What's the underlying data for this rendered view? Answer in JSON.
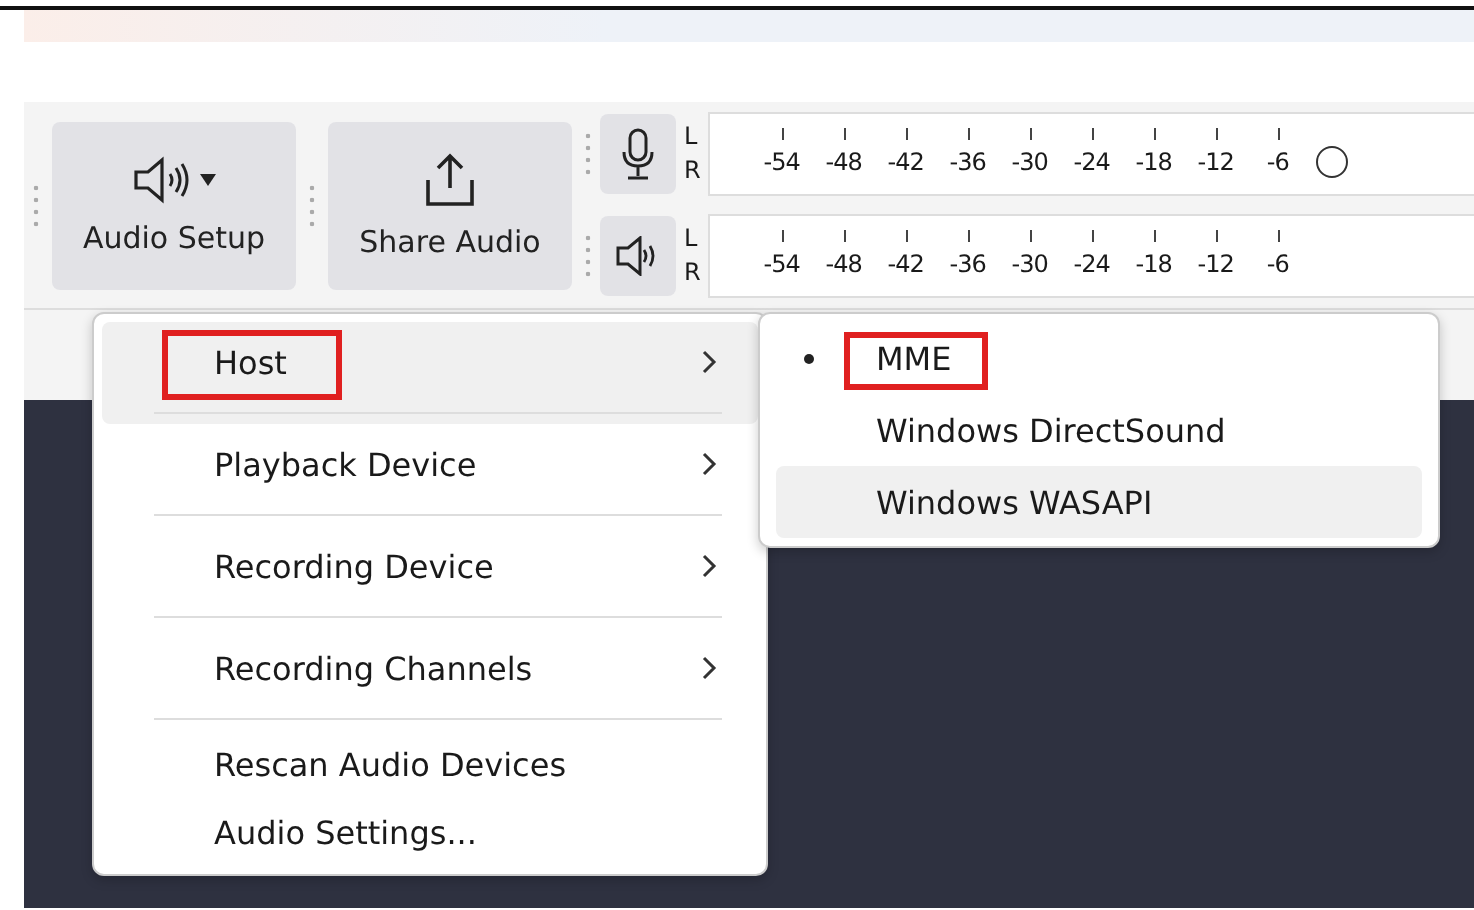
{
  "toolbar": {
    "buttons": [
      {
        "label": "Audio Setup",
        "kind": "speaker",
        "dropdown": true
      },
      {
        "label": "Share Audio",
        "kind": "share",
        "dropdown": false
      }
    ]
  },
  "meters": [
    {
      "kind": "recording",
      "channels": [
        "L",
        "R"
      ],
      "ticks": [
        "-54",
        "-48",
        "-42",
        "-36",
        "-30",
        "-24",
        "-18",
        "-12",
        "-6"
      ],
      "end_mark": true
    },
    {
      "kind": "playback",
      "channels": [
        "L",
        "R"
      ],
      "ticks": [
        "-54",
        "-48",
        "-42",
        "-36",
        "-30",
        "-24",
        "-18",
        "-12",
        "-6"
      ],
      "end_mark": false
    }
  ],
  "menu": {
    "items": [
      {
        "label": "Host",
        "kind": "submenu",
        "hovered": true,
        "annotated": true,
        "separator_after": true
      },
      {
        "label": "Playback Device",
        "kind": "submenu",
        "hovered": false,
        "annotated": false,
        "separator_after": true
      },
      {
        "label": "Recording Device",
        "kind": "submenu",
        "hovered": false,
        "annotated": false,
        "separator_after": true
      },
      {
        "label": "Recording Channels",
        "kind": "submenu",
        "hovered": false,
        "annotated": false,
        "separator_after": true
      },
      {
        "label": "Rescan Audio Devices",
        "kind": "action",
        "hovered": false,
        "annotated": false,
        "separator_after": false
      },
      {
        "label": "Audio Settings...",
        "kind": "action",
        "hovered": false,
        "annotated": false,
        "separator_after": false
      }
    ]
  },
  "submenu": {
    "items": [
      {
        "label": "MME",
        "selected": true,
        "hovered": false,
        "annotated": true
      },
      {
        "label": "Windows DirectSound",
        "selected": false,
        "hovered": false,
        "annotated": false
      },
      {
        "label": "Windows WASAPI",
        "selected": false,
        "hovered": true,
        "annotated": false
      }
    ]
  }
}
